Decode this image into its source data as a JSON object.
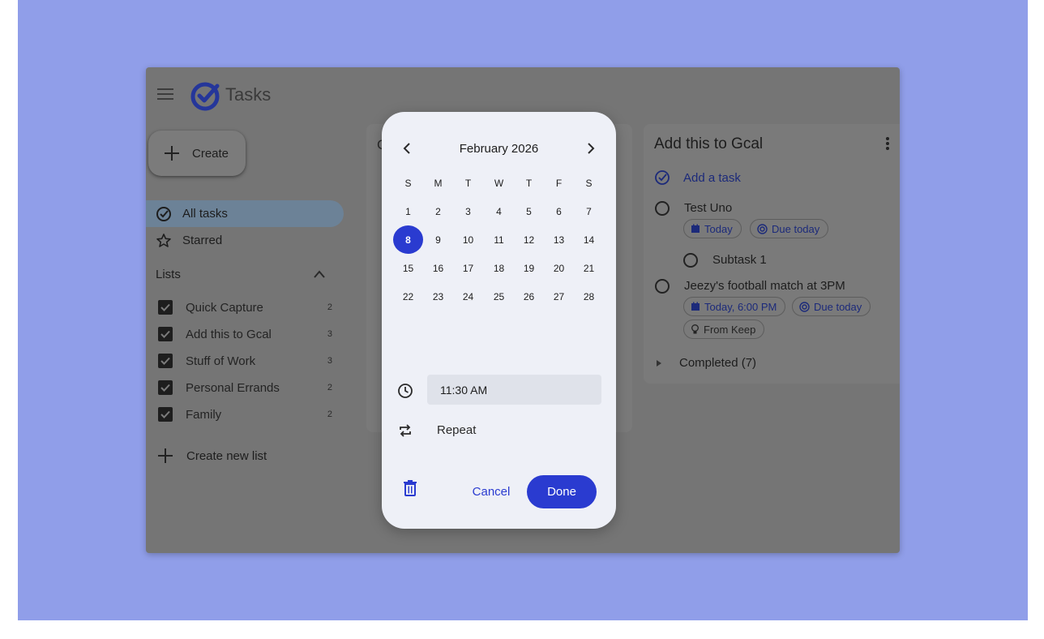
{
  "app": {
    "title": "Tasks"
  },
  "sidebar": {
    "create_label": "Create",
    "nav": [
      {
        "label": "All tasks",
        "icon": "check-circle-icon",
        "active": true
      },
      {
        "label": "Starred",
        "icon": "star-icon",
        "active": false
      }
    ],
    "lists_header": "Lists",
    "lists": [
      {
        "label": "Quick Capture",
        "count": "2"
      },
      {
        "label": "Add this to Gcal",
        "count": "3"
      },
      {
        "label": "Stuff of Work",
        "count": "3"
      },
      {
        "label": "Personal Errands",
        "count": "2"
      },
      {
        "label": "Family",
        "count": "2"
      }
    ],
    "create_list_label": "Create new list"
  },
  "middle": {
    "fragment_letter": "C"
  },
  "right_panel": {
    "title": "Add this to Gcal",
    "add_task_label": "Add a task",
    "tasks": [
      {
        "title": "Test Uno",
        "chips": [
          "Today",
          "Due today"
        ]
      },
      {
        "title": "Subtask 1",
        "chips": []
      },
      {
        "title": "Jeezy's football match at 3PM",
        "chips": [
          "Today, 6:00 PM",
          "Due today",
          "From Keep"
        ]
      }
    ],
    "completed_label": "Completed (7)"
  },
  "date_picker": {
    "month_label": "February 2026",
    "weekdays": [
      "S",
      "M",
      "T",
      "W",
      "T",
      "F",
      "S"
    ],
    "weeks": [
      [
        "1",
        "2",
        "3",
        "4",
        "5",
        "6",
        "7"
      ],
      [
        "8",
        "9",
        "10",
        "11",
        "12",
        "13",
        "14"
      ],
      [
        "15",
        "16",
        "17",
        "18",
        "19",
        "20",
        "21"
      ],
      [
        "22",
        "23",
        "24",
        "25",
        "26",
        "27",
        "28"
      ]
    ],
    "selected_day": "8",
    "time_value": "11:30 AM",
    "repeat_label": "Repeat",
    "cancel_label": "Cancel",
    "done_label": "Done"
  },
  "colors": {
    "backdrop": "#909ee9",
    "scrim": "#757575",
    "accent": "#2a3bd0",
    "active_nav": "#6c8297"
  }
}
